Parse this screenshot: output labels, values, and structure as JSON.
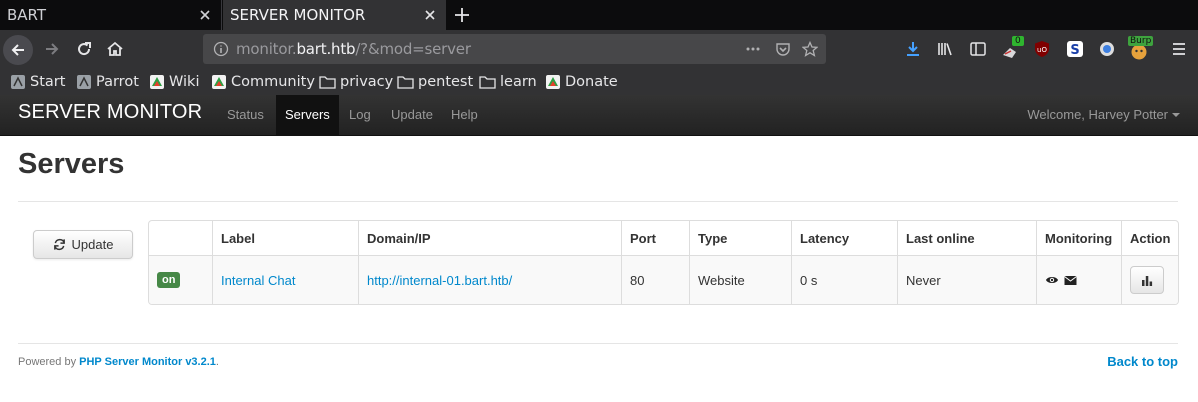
{
  "browser": {
    "tabs": [
      {
        "label": "BART",
        "active": false
      },
      {
        "label": "SERVER MONITOR",
        "active": true
      }
    ],
    "url": {
      "host": "monitor.bart.htb",
      "prefix": "monitor.",
      "domain": "bart.htb",
      "path": "/?&mod=server"
    },
    "bookmarks": [
      "Start",
      "Parrot",
      "Wiki",
      "Community",
      "privacy",
      "pentest",
      "learn",
      "Donate"
    ],
    "extension_badges": {
      "downloads_badge": "0",
      "burp_badge": "Burp"
    }
  },
  "app": {
    "brand": "SERVER MONITOR",
    "nav": [
      "Status",
      "Servers",
      "Log",
      "Update",
      "Help"
    ],
    "active_nav": "Servers",
    "welcome": "Welcome, Harvey Potter"
  },
  "page": {
    "title": "Servers",
    "update_button": "Update",
    "table": {
      "columns": [
        "",
        "Label",
        "Domain/IP",
        "Port",
        "Type",
        "Latency",
        "Last online",
        "Monitoring",
        "Action"
      ],
      "rows": [
        {
          "status": "on",
          "label": "Internal Chat",
          "domain": "http://internal-01.bart.htb/",
          "port": "80",
          "type": "Website",
          "latency": "0 s",
          "last_online": "Never"
        }
      ]
    },
    "footer": {
      "powered_by": "Powered by",
      "product": "PHP Server Monitor v3.2.1",
      "period": ".",
      "back_to_top": "Back to top"
    }
  },
  "colors": {
    "link": "#0088cc",
    "on_badge": "#468847",
    "appbar": "#222222"
  }
}
